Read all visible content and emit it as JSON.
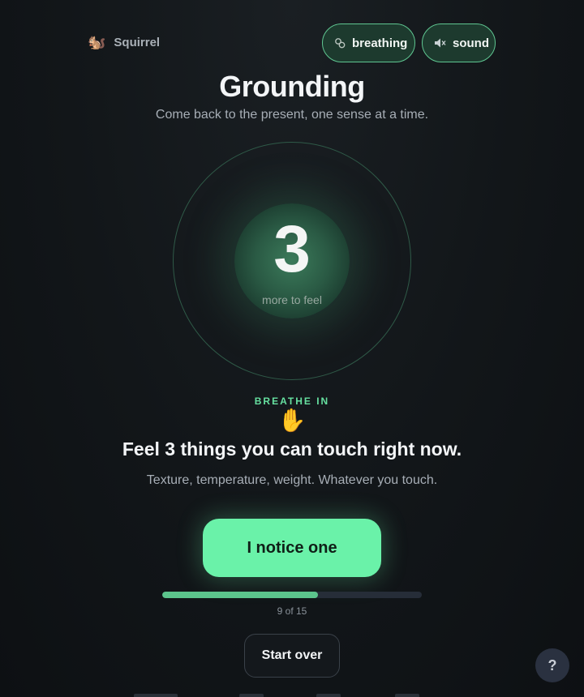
{
  "brand": {
    "icon": "squirrel-emoji",
    "glyph": "🐿️",
    "name": "Squirrel"
  },
  "toggles": [
    {
      "label": "breathing",
      "icon": "breathing-icon"
    },
    {
      "label": "sound",
      "icon": "speaker-muted-icon"
    }
  ],
  "header": {
    "title": "Grounding",
    "subtitle": "Come back to the present, one sense at a time."
  },
  "counter": {
    "value": "3",
    "label": "more to feel"
  },
  "step": {
    "breath_cue": "BREATHE IN",
    "sense_emoji": "✋",
    "prompt": "Feel 3 things you can touch right now.",
    "hint": "Texture, temperature, weight. Whatever you touch."
  },
  "actions": {
    "primary_label": "I notice one",
    "restart_label": "Start over"
  },
  "progress": {
    "current": 9,
    "total": 15,
    "text": "9 of 15"
  },
  "help": {
    "label": "?"
  },
  "colors": {
    "accent": "#6af2a9",
    "accent_dark": "#5cc48c",
    "background": "#121619"
  }
}
